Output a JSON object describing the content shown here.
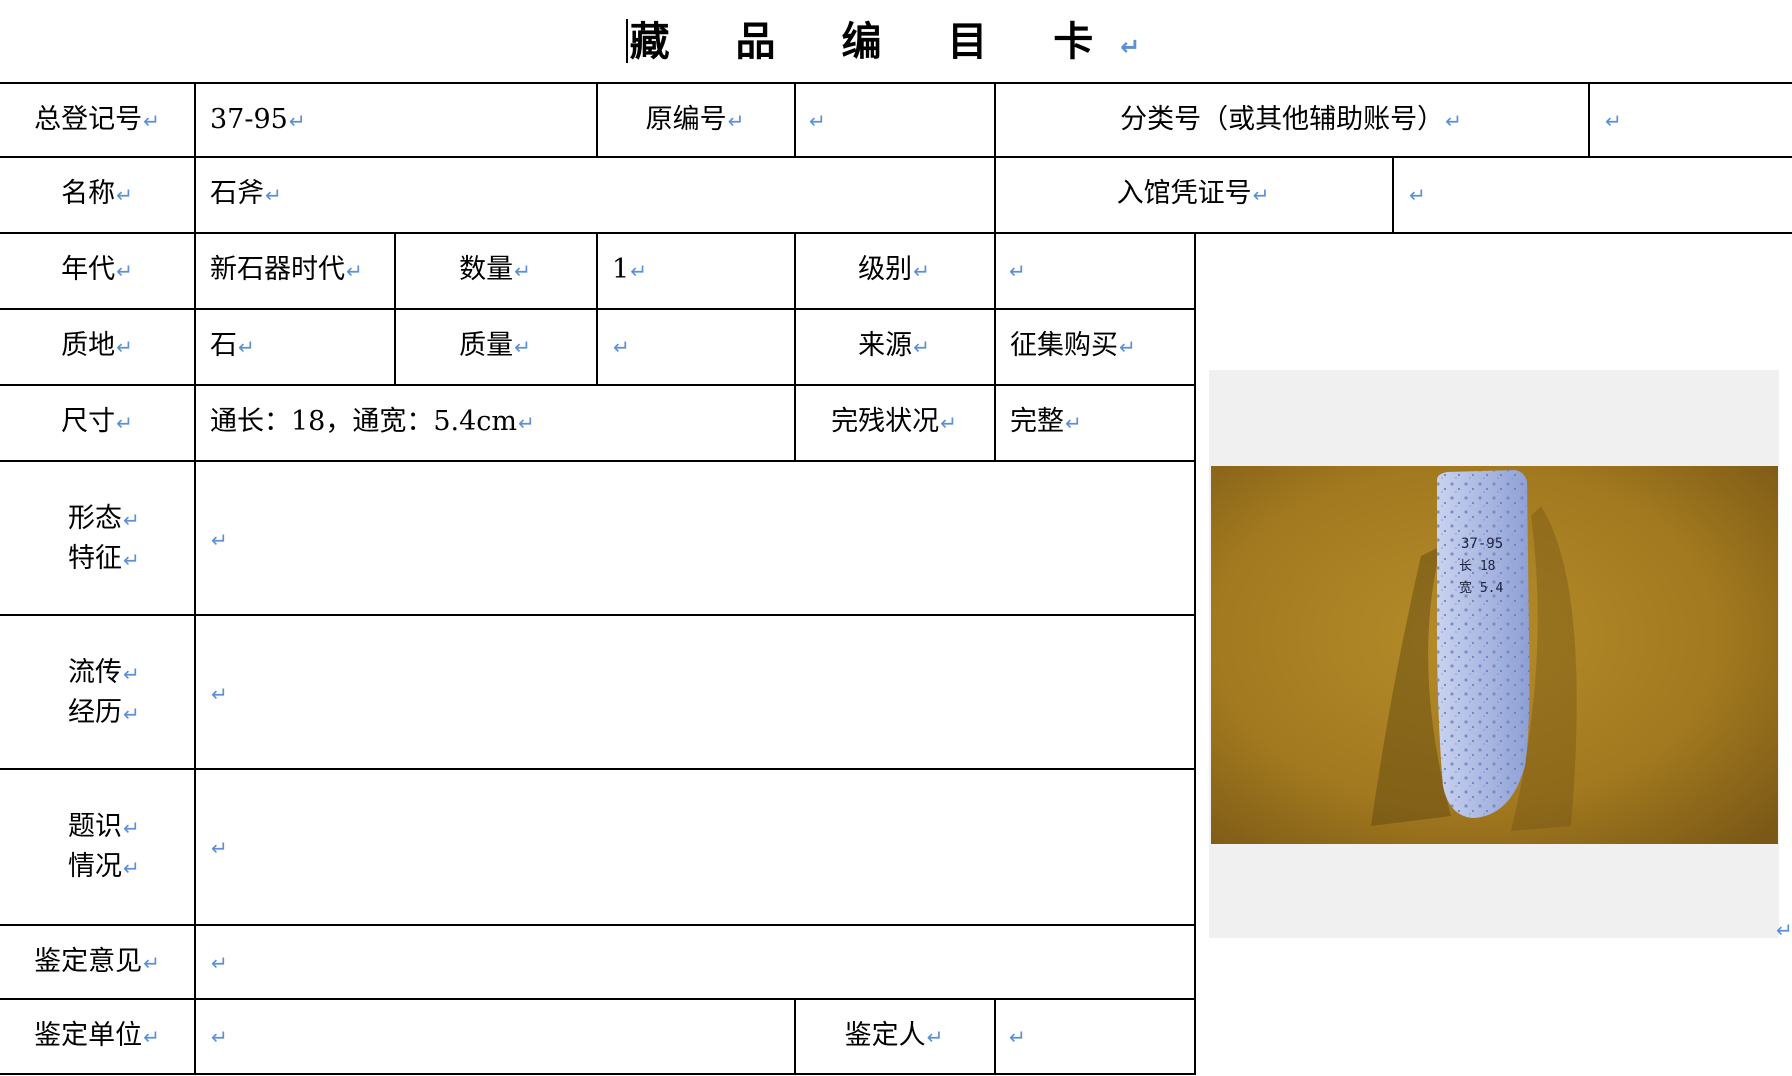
{
  "title": "藏 品 编 目 卡",
  "paragraph_mark": "↵",
  "rows": {
    "reg_no_label": "总登记号",
    "reg_no_value": "37-95",
    "orig_no_label": "原编号",
    "class_no_label": "分类号（或其他辅助账号）",
    "name_label": "名称",
    "name_value": "石斧",
    "voucher_label": "入馆凭证号",
    "era_label": "年代",
    "era_value": "新石器时代",
    "qty_label": "数量",
    "qty_value": "1",
    "grade_label": "级别",
    "material_label": "质地",
    "material_value": "石",
    "mass_label": "质量",
    "source_label": "来源",
    "source_value": "征集购买",
    "size_label": "尺寸",
    "size_value": "通长：18，通宽：5.4cm",
    "condition_label": "完残状况",
    "condition_value": "完整",
    "form_label_1": "形态",
    "form_label_2": "特征",
    "history_label_1": "流传",
    "history_label_2": "经历",
    "inscription_label_1": "题识",
    "inscription_label_2": "情况",
    "appraisal_label": "鉴定意见",
    "appraiser_unit_label": "鉴定单位",
    "appraiser_label": "鉴定人"
  },
  "photo": {
    "handwriting_line1": "37-95",
    "handwriting_line2": "长 18",
    "handwriting_line3": "宽 5.4",
    "background_color": "#a2791f",
    "stone_color": "#aebbe3"
  }
}
